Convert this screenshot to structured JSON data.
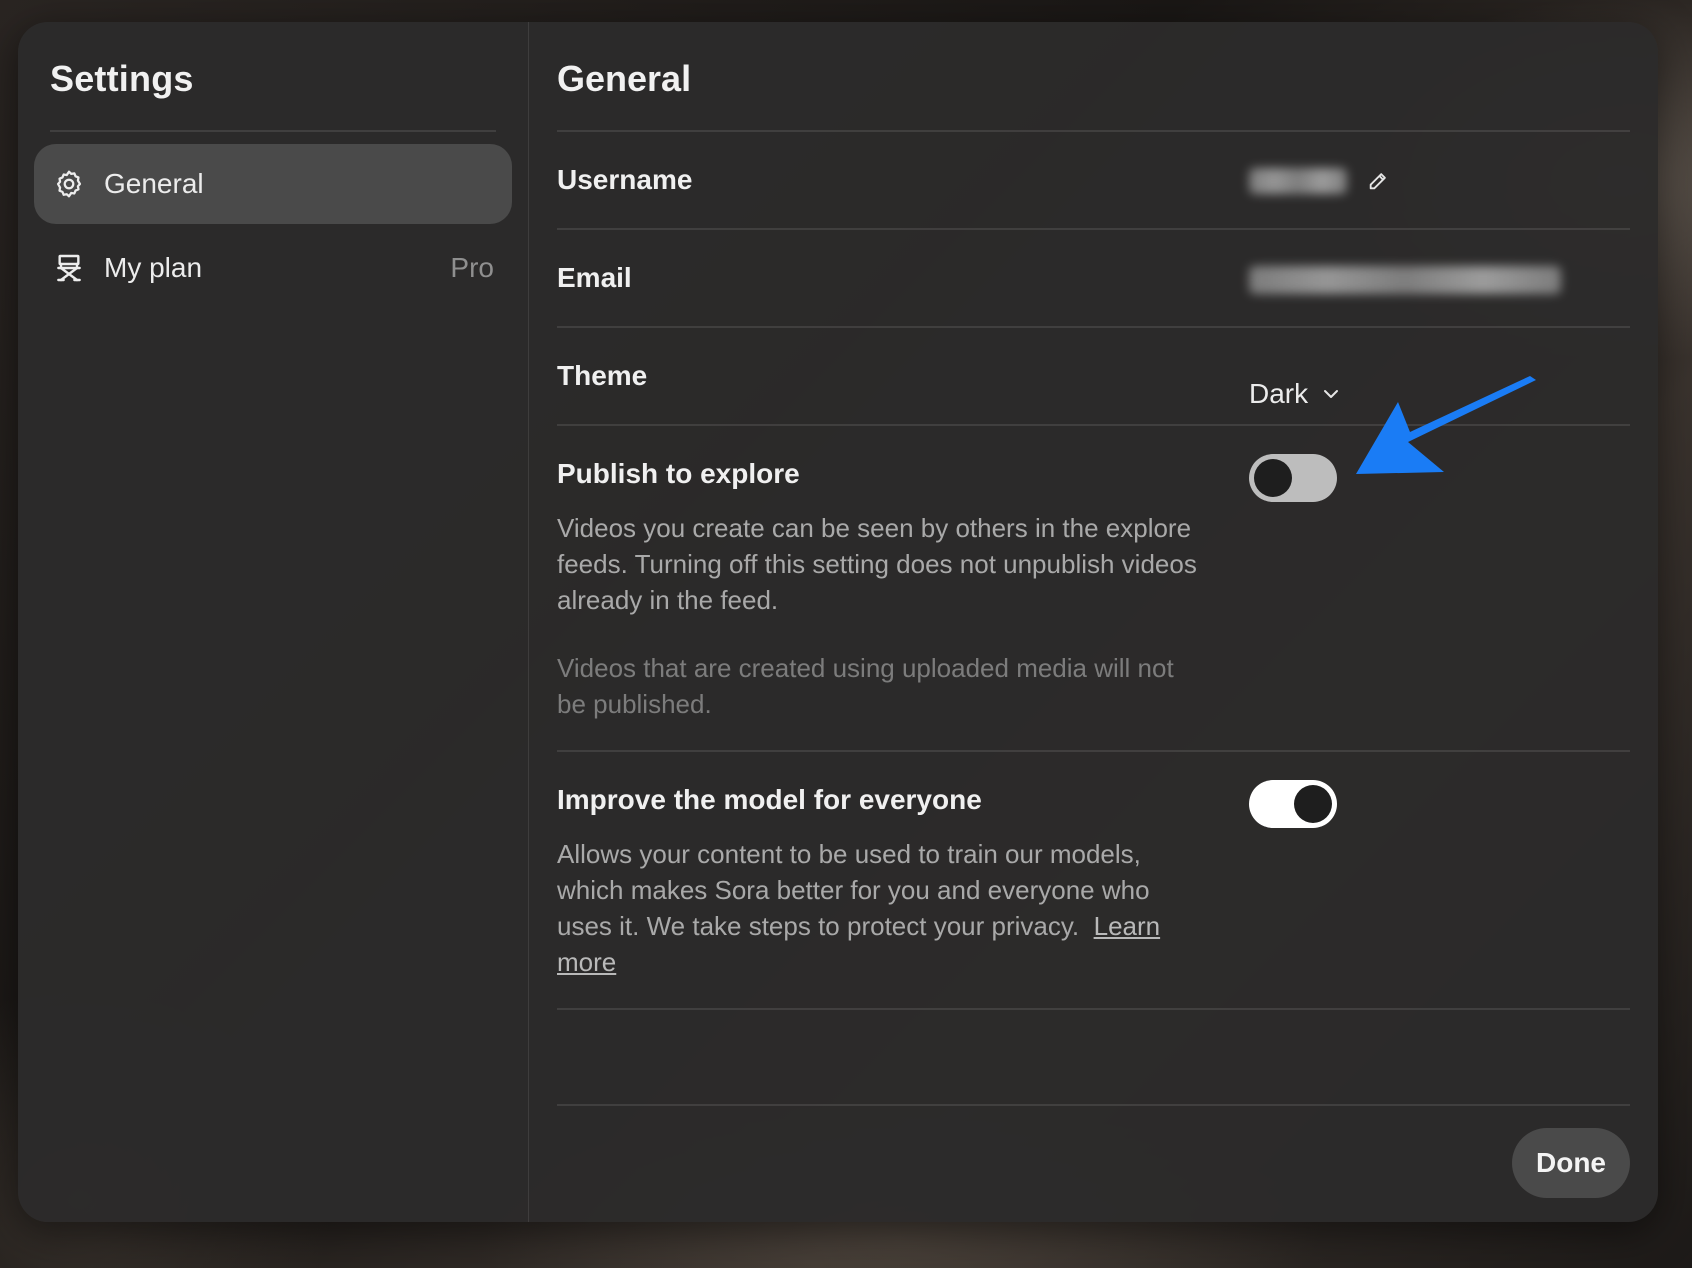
{
  "sidebar": {
    "title": "Settings",
    "items": [
      {
        "label": "General",
        "icon": "gear-icon",
        "active": true
      },
      {
        "label": "My plan",
        "icon": "director-chair-icon",
        "badge": "Pro",
        "active": false
      }
    ]
  },
  "main": {
    "title": "General",
    "username": {
      "label": "Username",
      "value_redacted": true,
      "edit_icon": "pencil-icon"
    },
    "email": {
      "label": "Email",
      "value_redacted": true
    },
    "theme": {
      "label": "Theme",
      "value": "Dark",
      "icon": "chevron-down-icon"
    },
    "publish": {
      "label": "Publish to explore",
      "enabled": false,
      "description": "Videos you create can be seen by others in the explore feeds. Turning off this setting does not unpublish videos already in the feed.",
      "note": "Videos that are created using uploaded media will not be published."
    },
    "improve": {
      "label": "Improve the model for everyone",
      "enabled": true,
      "description": "Allows your content to be used to train our models, which makes Sora better for you and everyone who uses it. We take steps to protect your privacy.",
      "link": "Learn more"
    }
  },
  "footer": {
    "done_label": "Done"
  },
  "annotation": {
    "arrow_color": "#1a7cf5",
    "icon": "pointer-arrow-icon"
  },
  "colors": {
    "modal_bg": "#2c2b2b",
    "active_item_bg": "#4a4a4a",
    "accent_arrow": "#1a7cf5"
  }
}
